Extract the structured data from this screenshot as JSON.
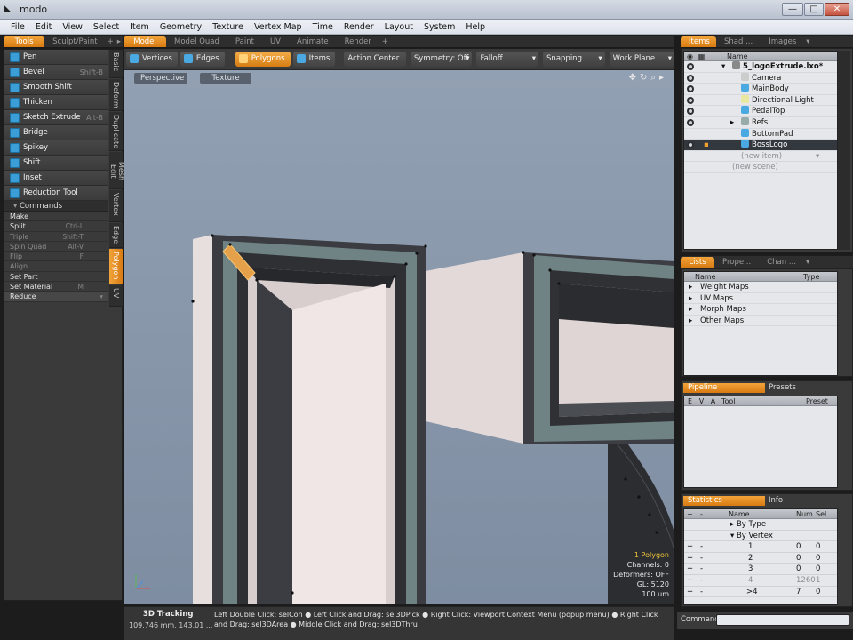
{
  "window": {
    "title": "modo",
    "btn_min": "—",
    "btn_max": "□",
    "btn_close": "✕"
  },
  "menu": [
    "File",
    "Edit",
    "View",
    "Select",
    "Item",
    "Geometry",
    "Texture",
    "Vertex Map",
    "Time",
    "Render",
    "Layout",
    "System",
    "Help"
  ],
  "left_tabs": {
    "tools": "Tools",
    "sculpt": "Sculpt/Paint",
    "plus": "+",
    "arrow": "▸"
  },
  "tools": [
    {
      "label": "Pen",
      "shortcut": ""
    },
    {
      "label": "Bevel",
      "shortcut": "Shift-B"
    },
    {
      "label": "Smooth Shift",
      "shortcut": ""
    },
    {
      "label": "Thicken",
      "shortcut": ""
    },
    {
      "label": "Sketch Extrude",
      "shortcut": "Alt-B"
    },
    {
      "label": "Bridge",
      "shortcut": ""
    },
    {
      "label": "Spikey",
      "shortcut": ""
    },
    {
      "label": "Shift",
      "shortcut": ""
    },
    {
      "label": "Inset",
      "shortcut": ""
    },
    {
      "label": "Reduction Tool",
      "shortcut": ""
    }
  ],
  "commands_header": "Commands",
  "commands": [
    {
      "label": "Make",
      "shortcut": "",
      "dim": false
    },
    {
      "label": "Split",
      "shortcut": "Ctrl-L",
      "dim": false
    },
    {
      "label": "Triple",
      "shortcut": "Shift-T",
      "dim": true
    },
    {
      "label": "Spin Quad",
      "shortcut": "Alt-V",
      "dim": true
    },
    {
      "label": "Flip",
      "shortcut": "F",
      "dim": true
    },
    {
      "label": "Align",
      "shortcut": "",
      "dim": true
    },
    {
      "label": "Set Part",
      "shortcut": "",
      "dim": false
    },
    {
      "label": "Set Material",
      "shortcut": "M",
      "dim": false
    },
    {
      "label": "Reduce",
      "shortcut": "▾",
      "dim": false
    }
  ],
  "vtabs": [
    "Basic",
    "Deform",
    "Duplicate",
    "Mesh Edit",
    "Vertex",
    "Edge",
    "Polygon",
    "UV"
  ],
  "center_tabs": [
    "Model",
    "Model Quad",
    "Paint",
    "UV",
    "Animate",
    "Render",
    "+"
  ],
  "viewport_header": {
    "vertices": "Vertices",
    "edges": "Edges",
    "polygons": "Polygons",
    "items": "Items",
    "action_center": "Action Center",
    "symmetry": "Symmetry: Off",
    "falloff": "Falloff",
    "snapping": "Snapping",
    "work_plane": "Work Plane"
  },
  "viewport": {
    "perspective": "Perspective",
    "texture": "Texture",
    "hud": [
      "1 Polygon",
      "Channels: 0",
      "Deformers: OFF",
      "GL: 5120",
      "100 um"
    ],
    "hud_accent": "#f0c43a"
  },
  "status": {
    "mode": "3D Tracking",
    "coords": "109.746 mm, 143.01 ...",
    "hints": "Left Double Click: selCon ● Left Click and Drag: sel3DPick ● Right Click: Viewport Context Menu (popup menu) ● Right Click and Drag: sel3DArea ● Middle Click and Drag: sel3DThru"
  },
  "right_tabs_top": [
    "Items",
    "Shad ...",
    "Images",
    "▾"
  ],
  "items_col": "Name",
  "items": [
    {
      "name": "5_logoExtrude.lxo*",
      "indent": 2,
      "type": "scene"
    },
    {
      "name": "Camera",
      "indent": 3,
      "type": "item"
    },
    {
      "name": "MainBody",
      "indent": 3,
      "type": "item"
    },
    {
      "name": "Directional Light",
      "indent": 3,
      "type": "item"
    },
    {
      "name": "PedalTop",
      "indent": 3,
      "type": "item"
    },
    {
      "name": "Refs",
      "indent": 3,
      "type": "group"
    },
    {
      "name": "BottomPad",
      "indent": 3,
      "type": "item"
    },
    {
      "name": "BossLogo",
      "indent": 3,
      "type": "item",
      "selected": true
    },
    {
      "name": "(new item)",
      "indent": 3,
      "type": "ghost"
    },
    {
      "name": "(new scene)",
      "indent": 2,
      "type": "ghost"
    }
  ],
  "right_tabs_mid": [
    "Lists",
    "Prope...",
    "Chan ...",
    "▾"
  ],
  "lists_cols": {
    "name": "Name",
    "type": "Type"
  },
  "lists": [
    "Weight Maps",
    "UV Maps",
    "Morph Maps",
    "Other Maps"
  ],
  "pipeline_tabs": [
    "Pipeline",
    "Presets"
  ],
  "pipeline_cols": [
    "E",
    "V",
    "A",
    "Tool",
    "Preset"
  ],
  "stats_tabs": [
    "Statistics",
    "Info"
  ],
  "stats_cols": {
    "plus": "+",
    "minus": "-",
    "name": "Name",
    "num": "Num",
    "sel": "Sel"
  },
  "stats": [
    {
      "name": "▸  By Type",
      "num": "",
      "sel": "",
      "pm": false,
      "dim": false
    },
    {
      "name": "▾  By Vertex",
      "num": "",
      "sel": "",
      "pm": false,
      "dim": false
    },
    {
      "name": "1",
      "num": "0",
      "sel": "0",
      "pm": true,
      "dim": false
    },
    {
      "name": "2",
      "num": "0",
      "sel": "0",
      "pm": true,
      "dim": false
    },
    {
      "name": "3",
      "num": "0",
      "sel": "0",
      "pm": true,
      "dim": false
    },
    {
      "name": "4",
      "num": "1260",
      "sel": "1",
      "pm": true,
      "dim": true
    },
    {
      "name": ">4",
      "num": "7",
      "sel": "0",
      "pm": true,
      "dim": false
    }
  ],
  "command_label": "Command"
}
